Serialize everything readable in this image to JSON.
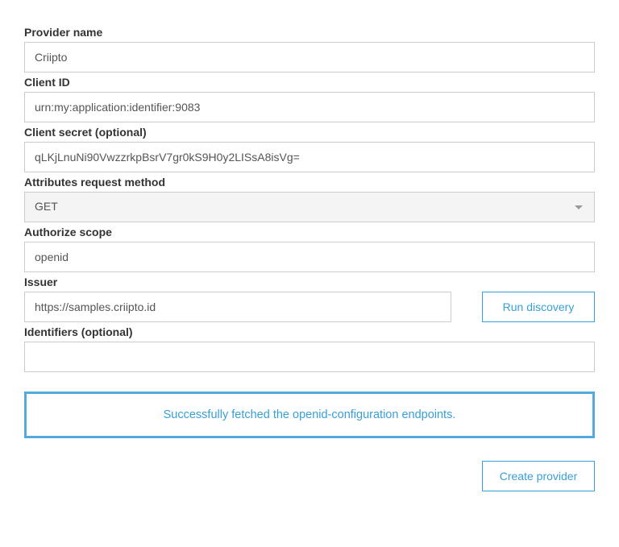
{
  "fields": {
    "providerName": {
      "label": "Provider name",
      "value": "Criipto"
    },
    "clientId": {
      "label": "Client ID",
      "value": "urn:my:application:identifier:9083"
    },
    "clientSecret": {
      "label": "Client secret (optional)",
      "value": "qLKjLnuNi90VwzzrkpBsrV7gr0kS9H0y2LISsA8isVg="
    },
    "attributesMethod": {
      "label": "Attributes request method",
      "value": "GET"
    },
    "authorizeScope": {
      "label": "Authorize scope",
      "value": "openid"
    },
    "issuer": {
      "label": "Issuer",
      "value": "https://samples.criipto.id"
    },
    "identifiers": {
      "label": "Identifiers (optional)",
      "value": ""
    }
  },
  "buttons": {
    "runDiscovery": "Run discovery",
    "createProvider": "Create provider"
  },
  "alert": {
    "successMessage": "Successfully fetched the openid-configuration endpoints."
  }
}
